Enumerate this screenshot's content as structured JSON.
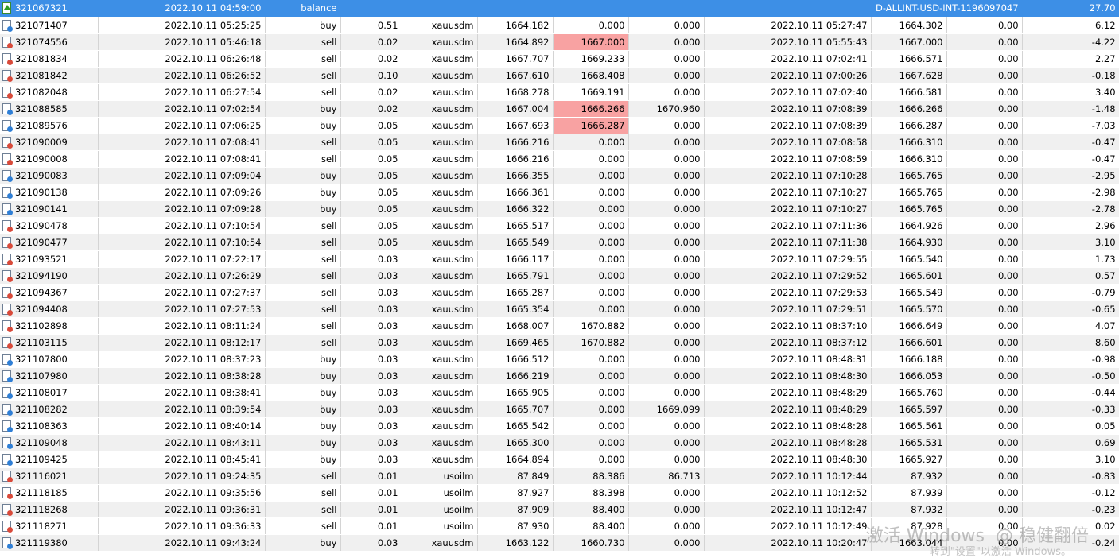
{
  "balance_row": {
    "ticket": "321067321",
    "time": "2022.10.11 04:59:00",
    "type": "balance",
    "comment": "D-ALLINT-USD-INT-1196097047",
    "profit": "27.70"
  },
  "rows": [
    [
      "321071407",
      "2022.10.11 05:25:25",
      "buy",
      "0.51",
      "xauusdm",
      "1664.182",
      "0.000",
      "0.000",
      "2022.10.11 05:27:47",
      "1664.302",
      "0.00",
      "6.12"
    ],
    [
      "321074556",
      "2022.10.11 05:46:18",
      "sell",
      "0.02",
      "xauusdm",
      "1664.892",
      "1667.000",
      "0.000",
      "2022.10.11 05:55:43",
      "1667.000",
      "0.00",
      "-4.22"
    ],
    [
      "321081834",
      "2022.10.11 06:26:48",
      "sell",
      "0.02",
      "xauusdm",
      "1667.707",
      "1669.233",
      "0.000",
      "2022.10.11 07:02:41",
      "1666.571",
      "0.00",
      "2.27"
    ],
    [
      "321081842",
      "2022.10.11 06:26:52",
      "sell",
      "0.10",
      "xauusdm",
      "1667.610",
      "1668.408",
      "0.000",
      "2022.10.11 07:00:26",
      "1667.628",
      "0.00",
      "-0.18"
    ],
    [
      "321082048",
      "2022.10.11 06:27:54",
      "sell",
      "0.02",
      "xauusdm",
      "1668.278",
      "1669.191",
      "0.000",
      "2022.10.11 07:02:40",
      "1666.581",
      "0.00",
      "3.40"
    ],
    [
      "321088585",
      "2022.10.11 07:02:54",
      "buy",
      "0.02",
      "xauusdm",
      "1667.004",
      "1666.266",
      "1670.960",
      "2022.10.11 07:08:39",
      "1666.266",
      "0.00",
      "-1.48"
    ],
    [
      "321089576",
      "2022.10.11 07:06:25",
      "buy",
      "0.05",
      "xauusdm",
      "1667.693",
      "1666.287",
      "0.000",
      "2022.10.11 07:08:39",
      "1666.287",
      "0.00",
      "-7.03"
    ],
    [
      "321090009",
      "2022.10.11 07:08:41",
      "sell",
      "0.05",
      "xauusdm",
      "1666.216",
      "0.000",
      "0.000",
      "2022.10.11 07:08:58",
      "1666.310",
      "0.00",
      "-0.47"
    ],
    [
      "321090008",
      "2022.10.11 07:08:41",
      "sell",
      "0.05",
      "xauusdm",
      "1666.216",
      "0.000",
      "0.000",
      "2022.10.11 07:08:59",
      "1666.310",
      "0.00",
      "-0.47"
    ],
    [
      "321090083",
      "2022.10.11 07:09:04",
      "buy",
      "0.05",
      "xauusdm",
      "1666.355",
      "0.000",
      "0.000",
      "2022.10.11 07:10:28",
      "1665.765",
      "0.00",
      "-2.95"
    ],
    [
      "321090138",
      "2022.10.11 07:09:26",
      "buy",
      "0.05",
      "xauusdm",
      "1666.361",
      "0.000",
      "0.000",
      "2022.10.11 07:10:27",
      "1665.765",
      "0.00",
      "-2.98"
    ],
    [
      "321090141",
      "2022.10.11 07:09:28",
      "buy",
      "0.05",
      "xauusdm",
      "1666.322",
      "0.000",
      "0.000",
      "2022.10.11 07:10:27",
      "1665.765",
      "0.00",
      "-2.78"
    ],
    [
      "321090478",
      "2022.10.11 07:10:54",
      "sell",
      "0.05",
      "xauusdm",
      "1665.517",
      "0.000",
      "0.000",
      "2022.10.11 07:11:36",
      "1664.926",
      "0.00",
      "2.96"
    ],
    [
      "321090477",
      "2022.10.11 07:10:54",
      "sell",
      "0.05",
      "xauusdm",
      "1665.549",
      "0.000",
      "0.000",
      "2022.10.11 07:11:38",
      "1664.930",
      "0.00",
      "3.10"
    ],
    [
      "321093521",
      "2022.10.11 07:22:17",
      "sell",
      "0.03",
      "xauusdm",
      "1666.117",
      "0.000",
      "0.000",
      "2022.10.11 07:29:55",
      "1665.540",
      "0.00",
      "1.73"
    ],
    [
      "321094190",
      "2022.10.11 07:26:29",
      "sell",
      "0.03",
      "xauusdm",
      "1665.791",
      "0.000",
      "0.000",
      "2022.10.11 07:29:52",
      "1665.601",
      "0.00",
      "0.57"
    ],
    [
      "321094367",
      "2022.10.11 07:27:37",
      "sell",
      "0.03",
      "xauusdm",
      "1665.287",
      "0.000",
      "0.000",
      "2022.10.11 07:29:53",
      "1665.549",
      "0.00",
      "-0.79"
    ],
    [
      "321094408",
      "2022.10.11 07:27:53",
      "sell",
      "0.03",
      "xauusdm",
      "1665.354",
      "0.000",
      "0.000",
      "2022.10.11 07:29:51",
      "1665.570",
      "0.00",
      "-0.65"
    ],
    [
      "321102898",
      "2022.10.11 08:11:24",
      "sell",
      "0.03",
      "xauusdm",
      "1668.007",
      "1670.882",
      "0.000",
      "2022.10.11 08:37:10",
      "1666.649",
      "0.00",
      "4.07"
    ],
    [
      "321103115",
      "2022.10.11 08:12:17",
      "sell",
      "0.03",
      "xauusdm",
      "1669.465",
      "1670.882",
      "0.000",
      "2022.10.11 08:37:12",
      "1666.601",
      "0.00",
      "8.60"
    ],
    [
      "321107800",
      "2022.10.11 08:37:23",
      "buy",
      "0.03",
      "xauusdm",
      "1666.512",
      "0.000",
      "0.000",
      "2022.10.11 08:48:31",
      "1666.188",
      "0.00",
      "-0.98"
    ],
    [
      "321107980",
      "2022.10.11 08:38:28",
      "buy",
      "0.03",
      "xauusdm",
      "1666.219",
      "0.000",
      "0.000",
      "2022.10.11 08:48:30",
      "1666.053",
      "0.00",
      "-0.50"
    ],
    [
      "321108017",
      "2022.10.11 08:38:41",
      "buy",
      "0.03",
      "xauusdm",
      "1665.905",
      "0.000",
      "0.000",
      "2022.10.11 08:48:29",
      "1665.760",
      "0.00",
      "-0.44"
    ],
    [
      "321108282",
      "2022.10.11 08:39:54",
      "buy",
      "0.03",
      "xauusdm",
      "1665.707",
      "0.000",
      "1669.099",
      "2022.10.11 08:48:29",
      "1665.597",
      "0.00",
      "-0.33"
    ],
    [
      "321108363",
      "2022.10.11 08:40:14",
      "buy",
      "0.03",
      "xauusdm",
      "1665.542",
      "0.000",
      "0.000",
      "2022.10.11 08:48:28",
      "1665.561",
      "0.00",
      "0.05"
    ],
    [
      "321109048",
      "2022.10.11 08:43:11",
      "buy",
      "0.03",
      "xauusdm",
      "1665.300",
      "0.000",
      "0.000",
      "2022.10.11 08:48:28",
      "1665.531",
      "0.00",
      "0.69"
    ],
    [
      "321109425",
      "2022.10.11 08:45:41",
      "buy",
      "0.03",
      "xauusdm",
      "1664.894",
      "0.000",
      "0.000",
      "2022.10.11 08:48:30",
      "1665.927",
      "0.00",
      "3.10"
    ],
    [
      "321116021",
      "2022.10.11 09:24:35",
      "sell",
      "0.01",
      "usoilm",
      "87.849",
      "88.386",
      "86.713",
      "2022.10.11 10:12:44",
      "87.932",
      "0.00",
      "-0.83"
    ],
    [
      "321118185",
      "2022.10.11 09:35:56",
      "sell",
      "0.01",
      "usoilm",
      "87.927",
      "88.398",
      "0.000",
      "2022.10.11 10:12:52",
      "87.939",
      "0.00",
      "-0.12"
    ],
    [
      "321118268",
      "2022.10.11 09:36:31",
      "sell",
      "0.01",
      "usoilm",
      "87.909",
      "88.400",
      "0.000",
      "2022.10.11 10:12:47",
      "87.932",
      "0.00",
      "-0.23"
    ],
    [
      "321118271",
      "2022.10.11 09:36:33",
      "sell",
      "0.01",
      "usoilm",
      "87.930",
      "88.400",
      "0.000",
      "2022.10.11 10:12:49",
      "87.928",
      "0.00",
      "0.02"
    ],
    [
      "321119380",
      "2022.10.11 09:43:24",
      "buy",
      "0.03",
      "xauusdm",
      "1663.122",
      "1660.730",
      "0.000",
      "2022.10.11 10:20:47",
      "1663.044",
      "0.00",
      "-0.24"
    ]
  ],
  "highlighted_sl_rows": [
    1,
    5,
    6
  ],
  "watermark": {
    "line1": "激活 Windows",
    "line2": "转到\"设置\"以激活 Windows。",
    "brand": "稳健翻倍"
  }
}
